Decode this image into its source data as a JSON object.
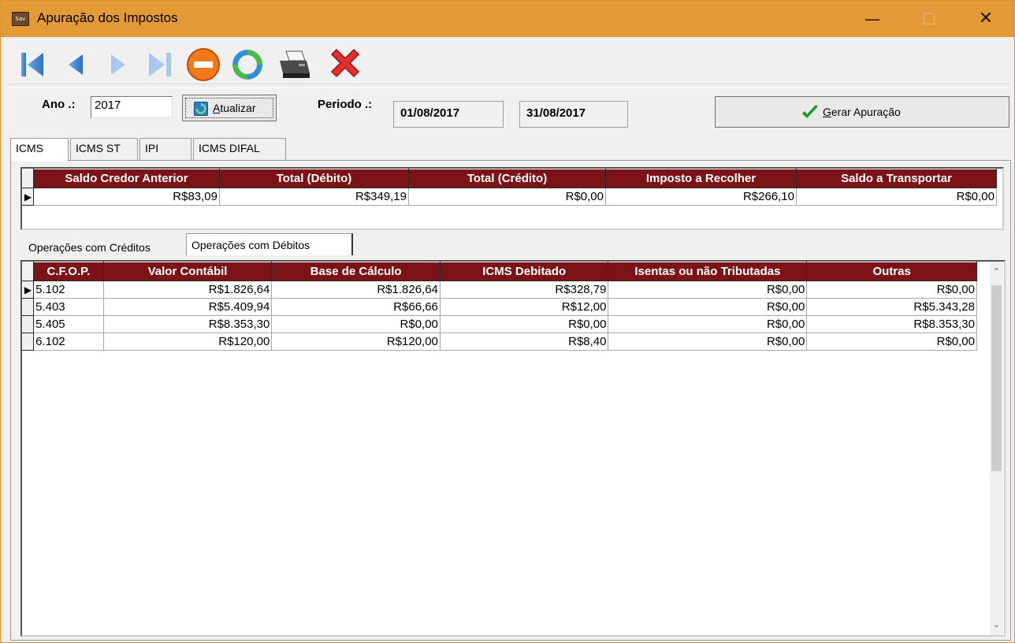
{
  "window": {
    "title": "Apuração dos Impostos",
    "app_icon_text": "Sav",
    "minimize": "—",
    "maximize": "☐",
    "close": "✕"
  },
  "toolbar": {
    "buttons": [
      {
        "name": "first-record-icon"
      },
      {
        "name": "prev-record-icon"
      },
      {
        "name": "next-record-icon"
      },
      {
        "name": "last-record-icon"
      },
      {
        "name": "cancel-icon"
      },
      {
        "name": "refresh-icon"
      },
      {
        "name": "print-icon"
      },
      {
        "name": "close-red-x-icon"
      }
    ]
  },
  "filters": {
    "ano_label": "Ano .:",
    "ano_value": "2017",
    "atualizar_label": "Atualizar",
    "atualizar_accel": "A",
    "atualizar_rest": "tualizar",
    "periodo_label": "Periodo .:",
    "periodo_inicio": "01/08/2017",
    "periodo_fim": "31/08/2017",
    "gerar_accel": "G",
    "gerar_rest": "erar Apuração"
  },
  "tabs": [
    "ICMS",
    "ICMS ST",
    "IPI",
    "ICMS DIFAL"
  ],
  "summary": {
    "columns": [
      "Saldo Credor Anterior",
      "Total (Débito)",
      "Total (Crédito)",
      "Imposto a Recolher",
      "Saldo a Transportar"
    ],
    "row": [
      "R$83,09",
      "R$349,19",
      "R$0,00",
      "R$266,10",
      "R$0,00"
    ]
  },
  "subtabs": [
    "Operações com Créditos",
    "Operações com Débitos"
  ],
  "detail": {
    "columns": [
      "C.F.O.P.",
      "Valor Contábil",
      "Base de Cálculo",
      "ICMS Debitado",
      "Isentas ou não Tributadas",
      "Outras"
    ],
    "rows": [
      [
        "5.102",
        "R$1.826,64",
        "R$1.826,64",
        "R$328,79",
        "R$0,00",
        "R$0,00"
      ],
      [
        "5.403",
        "R$5.409,94",
        "R$66,66",
        "R$12,00",
        "R$0,00",
        "R$5.343,28"
      ],
      [
        "5.405",
        "R$8.353,30",
        "R$0,00",
        "R$0,00",
        "R$0,00",
        "R$8.353,30"
      ],
      [
        "6.102",
        "R$120,00",
        "R$120,00",
        "R$8,40",
        "R$0,00",
        "R$0,00"
      ]
    ]
  },
  "colors": {
    "titlebar": "#e39a36",
    "grid_header": "#7c1417",
    "checkmark": "#1f9a1f"
  }
}
